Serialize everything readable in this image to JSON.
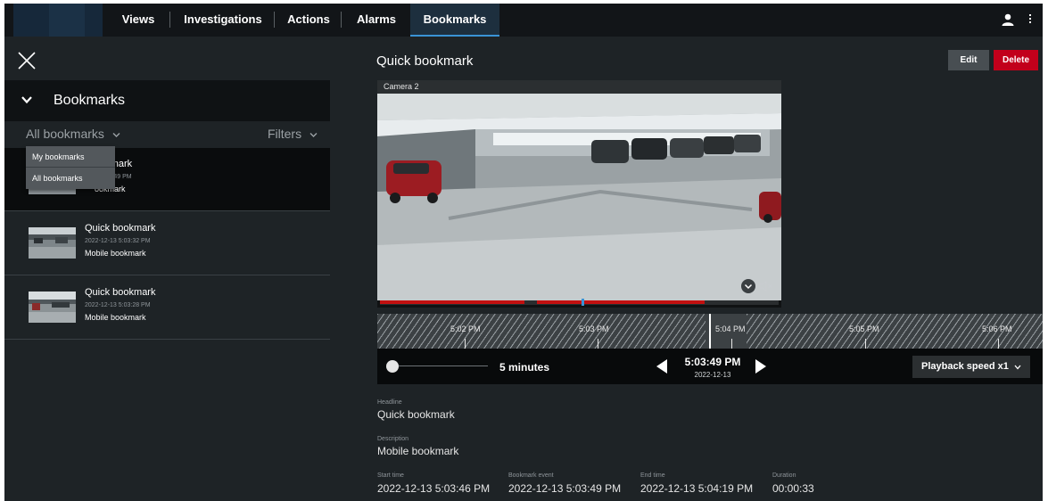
{
  "topnav": {
    "items": [
      {
        "label": "Views"
      },
      {
        "label": "Investigations"
      },
      {
        "label": "Actions"
      },
      {
        "label": "Alarms"
      },
      {
        "label": "Bookmarks",
        "active": true
      }
    ],
    "accent_color": "#3a93d6"
  },
  "sidebar": {
    "header_title": "Bookmarks",
    "selector_value": "All bookmarks",
    "filters_label": "Filters",
    "dropdown_options": [
      "My bookmarks",
      "All bookmarks"
    ],
    "items": [
      {
        "title": "Quick bookmark",
        "time": "2022-12-13 5:03:49 PM",
        "description": "Mobile bookmark",
        "visible_title": "ookmark",
        "visible_time": "3 5:03:49 PM",
        "visible_desc": "ookmark"
      },
      {
        "title": "Quick bookmark",
        "time": "2022-12-13 5:03:32 PM",
        "description": "Mobile bookmark"
      },
      {
        "title": "Quick bookmark",
        "time": "2022-12-13 5:03:28 PM",
        "description": "Mobile bookmark"
      }
    ]
  },
  "detail": {
    "title": "Quick bookmark",
    "edit_label": "Edit",
    "delete_label": "Delete",
    "delete_color": "#c2001b",
    "camera_label": "Camera 2",
    "timeline_labels": [
      "5:02 PM",
      "5:03 PM",
      "5:04 PM",
      "5:05 PM",
      "5:06 PM"
    ],
    "span_label": "5 minutes",
    "current_time": "5:03:49 PM",
    "current_date": "2022-12-13",
    "speed_label": "Playback speed x1",
    "headline_label": "Headline",
    "headline_value": "Quick bookmark",
    "description_label": "Description",
    "description_value": "Mobile bookmark",
    "start_label": "Start time",
    "start_value": "2022-12-13 5:03:46 PM",
    "event_label": "Bookmark event",
    "event_value": "2022-12-13 5:03:49 PM",
    "end_label": "End time",
    "end_value": "2022-12-13 5:04:19 PM",
    "duration_label": "Duration",
    "duration_value": "00:00:33"
  }
}
